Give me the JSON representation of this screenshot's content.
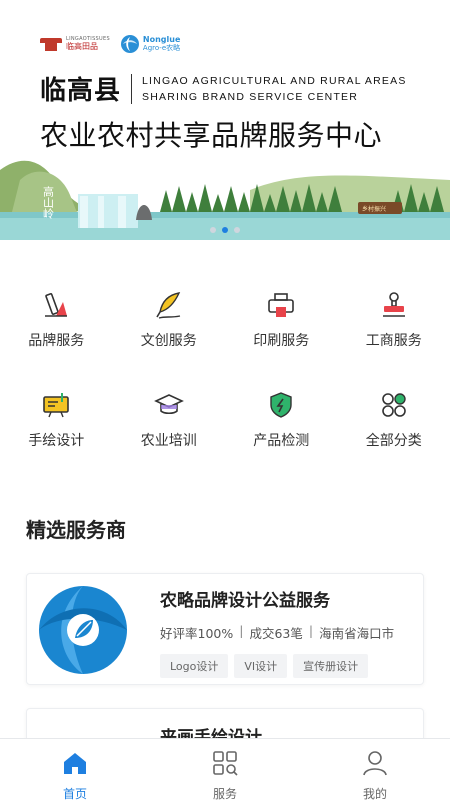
{
  "banner": {
    "logo_a_en": "LINGAOTISSUES",
    "logo_a_cn": "临高田品",
    "logo_b_en": "Nonglue",
    "logo_b_sub": "Agro-e农略",
    "county": "临高县",
    "en_line1": "LINGAO AGRICULTURAL AND RURAL AREAS",
    "en_line2": "SHARING BRAND SERVICE  CENTER",
    "main_title": "农业农村共享品牌服务中心",
    "scenery_text": "高山岭",
    "sign_text": "乡村振兴",
    "slides": 3,
    "active_slide": 2
  },
  "categories": [
    {
      "label": "品牌服务",
      "icon": "brand-pen-icon"
    },
    {
      "label": "文创服务",
      "icon": "quill-icon"
    },
    {
      "label": "印刷服务",
      "icon": "printer-icon"
    },
    {
      "label": "工商服务",
      "icon": "stamp-icon"
    },
    {
      "label": "手绘设计",
      "icon": "drawing-board-icon"
    },
    {
      "label": "农业培训",
      "icon": "graduation-cap-icon"
    },
    {
      "label": "产品检测",
      "icon": "shield-check-icon"
    },
    {
      "label": "全部分类",
      "icon": "all-categories-icon"
    }
  ],
  "section": {
    "title": "精选服务商"
  },
  "providers": [
    {
      "name": "农略品牌设计公益服务",
      "rating": "好评率100%",
      "deals": "成交63笔",
      "location": "海南省海口市",
      "tags": [
        "Logo设计",
        "VI设计",
        "宣传册设计"
      ]
    },
    {
      "name": "来画手绘设计"
    }
  ],
  "nav": [
    {
      "label": "首页",
      "active": true
    },
    {
      "label": "服务",
      "active": false
    },
    {
      "label": "我的",
      "active": false
    }
  ],
  "colors": {
    "accent": "#1e7fe0",
    "icon_red": "#e8434a",
    "icon_yellow": "#f3c323",
    "icon_green": "#2fb36b"
  }
}
